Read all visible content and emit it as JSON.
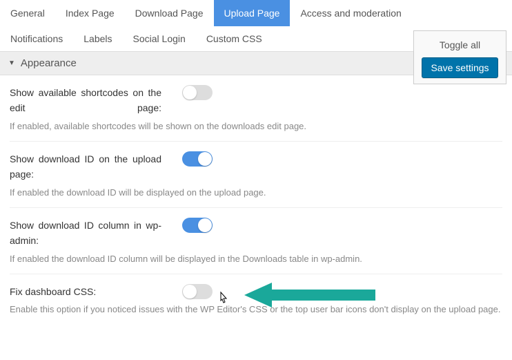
{
  "tabs": {
    "row1": [
      "General",
      "Index Page",
      "Download Page",
      "Upload Page",
      "Access and moderation"
    ],
    "row2": [
      "Notifications",
      "Labels",
      "Social Login",
      "Custom CSS"
    ],
    "active": "Upload Page"
  },
  "sidebox": {
    "toggle_all": "Toggle all",
    "save": "Save settings"
  },
  "section": {
    "title": "Appearance"
  },
  "settings": [
    {
      "label": "Show available shortcodes on the edit page:",
      "on": false,
      "desc": "If enabled, available shortcodes will be shown on the downloads edit page.",
      "name": "show-shortcodes"
    },
    {
      "label": "Show download ID on the upload page:",
      "on": true,
      "desc": "If enabled the download ID will be displayed on the upload page.",
      "name": "show-download-id-upload"
    },
    {
      "label": "Show download ID column in wp-admin:",
      "on": true,
      "desc": "If enabled the download ID column will be displayed in the Downloads table in wp-admin.",
      "name": "show-download-id-column"
    },
    {
      "label": "Fix dashboard CSS:",
      "on": false,
      "desc": "Enable this option if you noticed issues with the WP Editor's CSS or the top user bar icons don't display on the upload page.",
      "name": "fix-dashboard-css",
      "single": true,
      "arrow": true,
      "cursor": true
    }
  ]
}
